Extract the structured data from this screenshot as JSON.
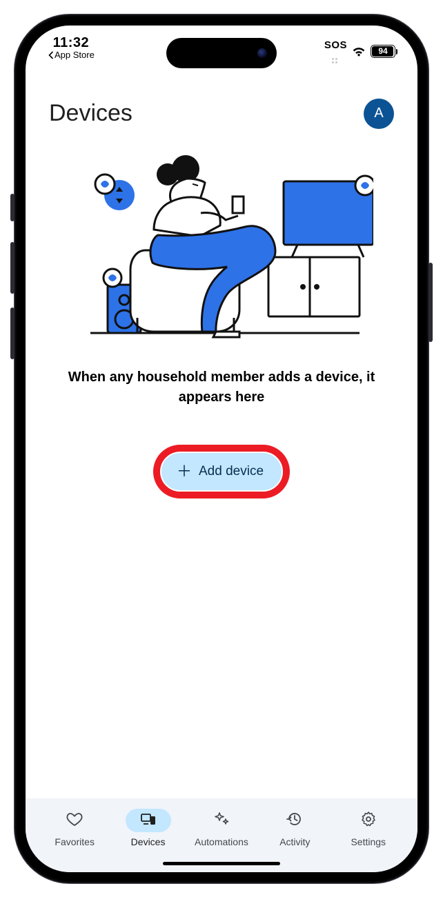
{
  "status_bar": {
    "time": "11:32",
    "back_app": "App Store",
    "sos": "SOS",
    "battery_pct": "94"
  },
  "header": {
    "title": "Devices",
    "avatar_initial": "A"
  },
  "main": {
    "empty_message": "When any household member adds a device, it appears here",
    "add_button_label": "Add device"
  },
  "tabs": [
    {
      "label": "Favorites",
      "icon": "heart",
      "active": false
    },
    {
      "label": "Devices",
      "icon": "devices",
      "active": true
    },
    {
      "label": "Automations",
      "icon": "sparkles",
      "active": false
    },
    {
      "label": "Activity",
      "icon": "history",
      "active": false
    },
    {
      "label": "Settings",
      "icon": "gear",
      "active": false
    }
  ],
  "colors": {
    "accent_blue": "#2e72e8",
    "accent_light": "#c2e7ff",
    "avatar_bg": "#0b5394",
    "highlight_red": "#ec1c24",
    "tabbar_bg": "#f1f4f9"
  }
}
